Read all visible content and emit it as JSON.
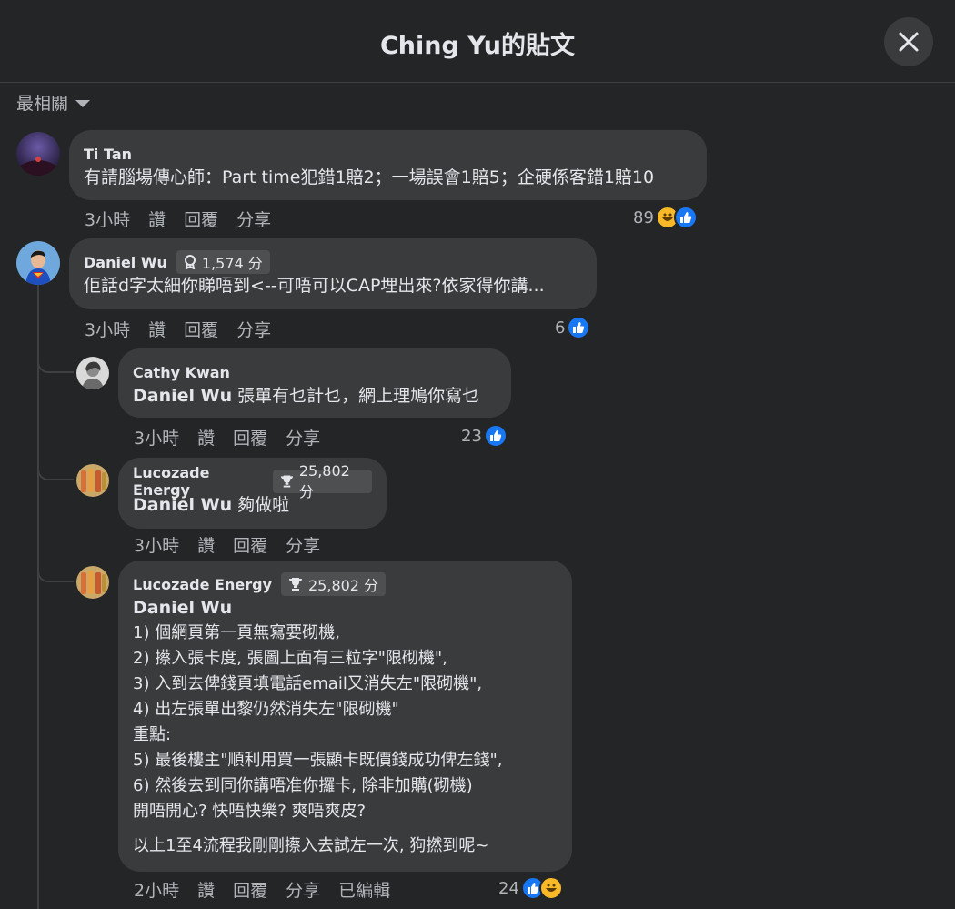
{
  "header": {
    "title": "Ching Yu的貼文"
  },
  "sort": {
    "label": "最相關"
  },
  "comments": [
    {
      "author": "Ti Tan",
      "text": "有請腦場傳心師：Part time犯錯1賠2；一場誤會1賠5；企硬係客錯1賠10",
      "time": "3小時",
      "like": "讚",
      "reply": "回覆",
      "share": "分享",
      "reactions": "89"
    },
    {
      "author": "Daniel Wu",
      "badge": "1,574 分",
      "text": "佢話d字太細你睇唔到<--可唔可以CAP埋出來?依家得你講...",
      "time": "3小時",
      "like": "讚",
      "reply": "回覆",
      "share": "分享",
      "reactions": "6"
    },
    {
      "author": "Cathy Kwan",
      "mention": "Daniel Wu",
      "text": " 張單有乜計乜，網上理鳩你寫乜",
      "time": "3小時",
      "like": "讚",
      "reply": "回覆",
      "share": "分享",
      "reactions": "23"
    },
    {
      "author": "Lucozade Energy",
      "badge": "25,802 分",
      "mention": "Daniel Wu",
      "text": " 夠做啦",
      "time": "3小時",
      "like": "讚",
      "reply": "回覆",
      "share": "分享"
    },
    {
      "author": "Lucozade Energy",
      "badge": "25,802 分",
      "mention": "Daniel Wu",
      "lines": [
        "1) 個網頁第一頁無寫要砌機,",
        "2) 攃入張卡度, 張圖上面有三粒字\"限砌機\",",
        "3) 入到去俾錢頁填電話email又消失左\"限砌機\",",
        "4) 出左張單出黎仍然消失左\"限砌機\"",
        "重點:",
        "5) 最後樓主\"順利用買一張顯卡既價錢成功俾左錢\",",
        "6) 然後去到同你講唔准你攞卡, 除非加購(砌機)",
        "開唔開心? 快唔快樂? 爽唔爽皮?"
      ],
      "last_line": "以上1至4流程我剛剛攃入去試左一次, 狗撚到呢~",
      "time": "2小時",
      "like": "讚",
      "reply": "回覆",
      "share": "分享",
      "edited": "已編輯",
      "reactions": "24"
    }
  ],
  "colors": {
    "background": "#242526",
    "bubble": "#3a3b3c",
    "like": "#1877f2",
    "haha": "#f7b928"
  }
}
